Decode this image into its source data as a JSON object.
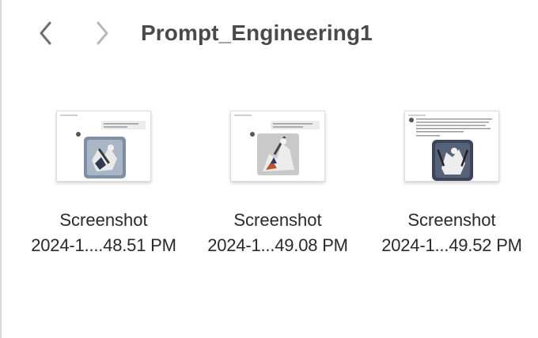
{
  "window": {
    "title": "Prompt_Engineering1"
  },
  "toolbar": {
    "back_icon": "chevron-left-icon",
    "forward_icon": "chevron-right-icon",
    "back_color": "#6e6e6e",
    "forward_color": "#b8b8b8"
  },
  "files": [
    {
      "name": "Screenshot",
      "date": "2024-1....48.51 PM"
    },
    {
      "name": "Screenshot",
      "date": "2024-1...49.08 PM"
    },
    {
      "name": "Screenshot",
      "date": "2024-1...49.52 PM"
    }
  ]
}
